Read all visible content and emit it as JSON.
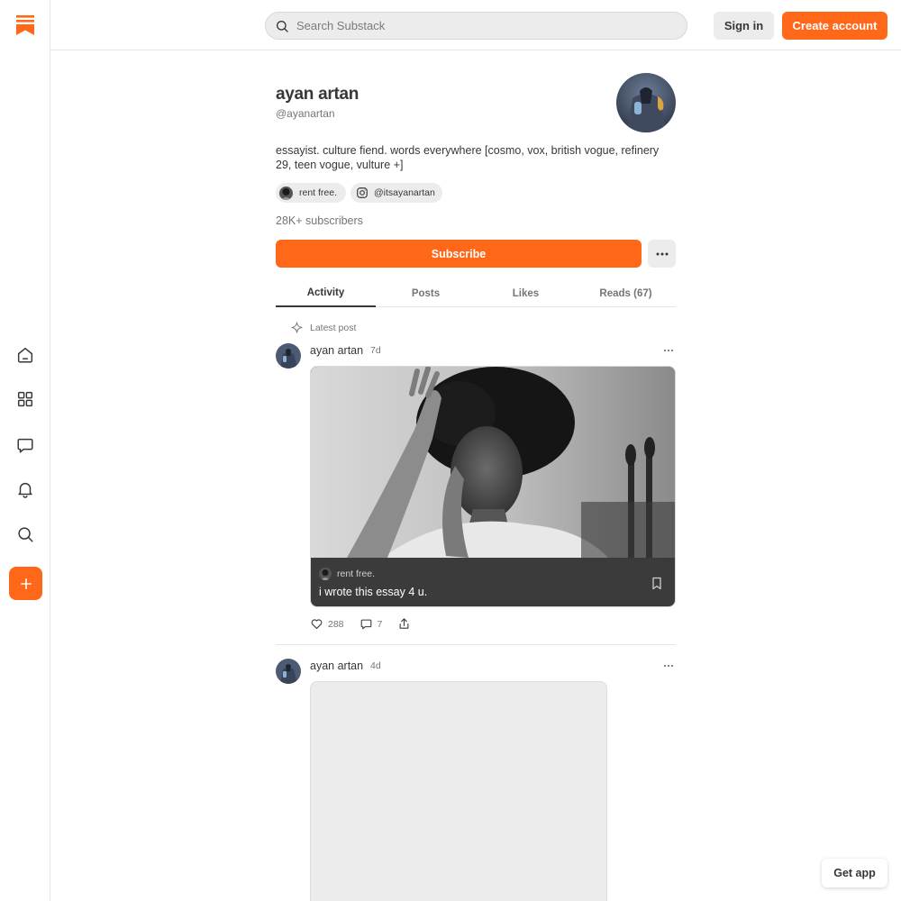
{
  "header": {
    "search_placeholder": "Search Substack",
    "sign_in_label": "Sign in",
    "create_account_label": "Create account"
  },
  "sidebar": {
    "items": [
      {
        "name": "home",
        "icon": "home-icon"
      },
      {
        "name": "explore",
        "icon": "grid-icon"
      },
      {
        "name": "chat",
        "icon": "chat-icon"
      },
      {
        "name": "activity",
        "icon": "bell-icon"
      },
      {
        "name": "search",
        "icon": "search-icon"
      },
      {
        "name": "create",
        "icon": "plus-icon"
      }
    ]
  },
  "profile": {
    "name": "ayan artan",
    "handle": "@ayanartan",
    "bio": "essayist. culture fiend. words everywhere [cosmo, vox, british vogue, refinery 29, teen vogue, vulture +]",
    "links": [
      {
        "label": "rent free.",
        "icon": "publication-avatar"
      },
      {
        "label": "@itsayanartan",
        "icon": "instagram-icon"
      }
    ],
    "subscribers": "28K+ subscribers",
    "subscribe_label": "Subscribe"
  },
  "tabs": [
    {
      "label": "Activity",
      "active": true
    },
    {
      "label": "Posts",
      "active": false
    },
    {
      "label": "Likes",
      "active": false
    },
    {
      "label": "Reads (67)",
      "active": false
    }
  ],
  "feed": {
    "latest_label": "Latest post",
    "posts": [
      {
        "author": "ayan artan",
        "time": "7d",
        "publication": "rent free.",
        "title": "i wrote this essay 4 u.",
        "likes": "288",
        "comments": "7"
      },
      {
        "author": "ayan artan",
        "time": "4d"
      }
    ]
  },
  "get_app_label": "Get app",
  "colors": {
    "accent": "#ff6719",
    "text": "#363737",
    "muted": "#757575",
    "chip_bg": "#ececec"
  }
}
